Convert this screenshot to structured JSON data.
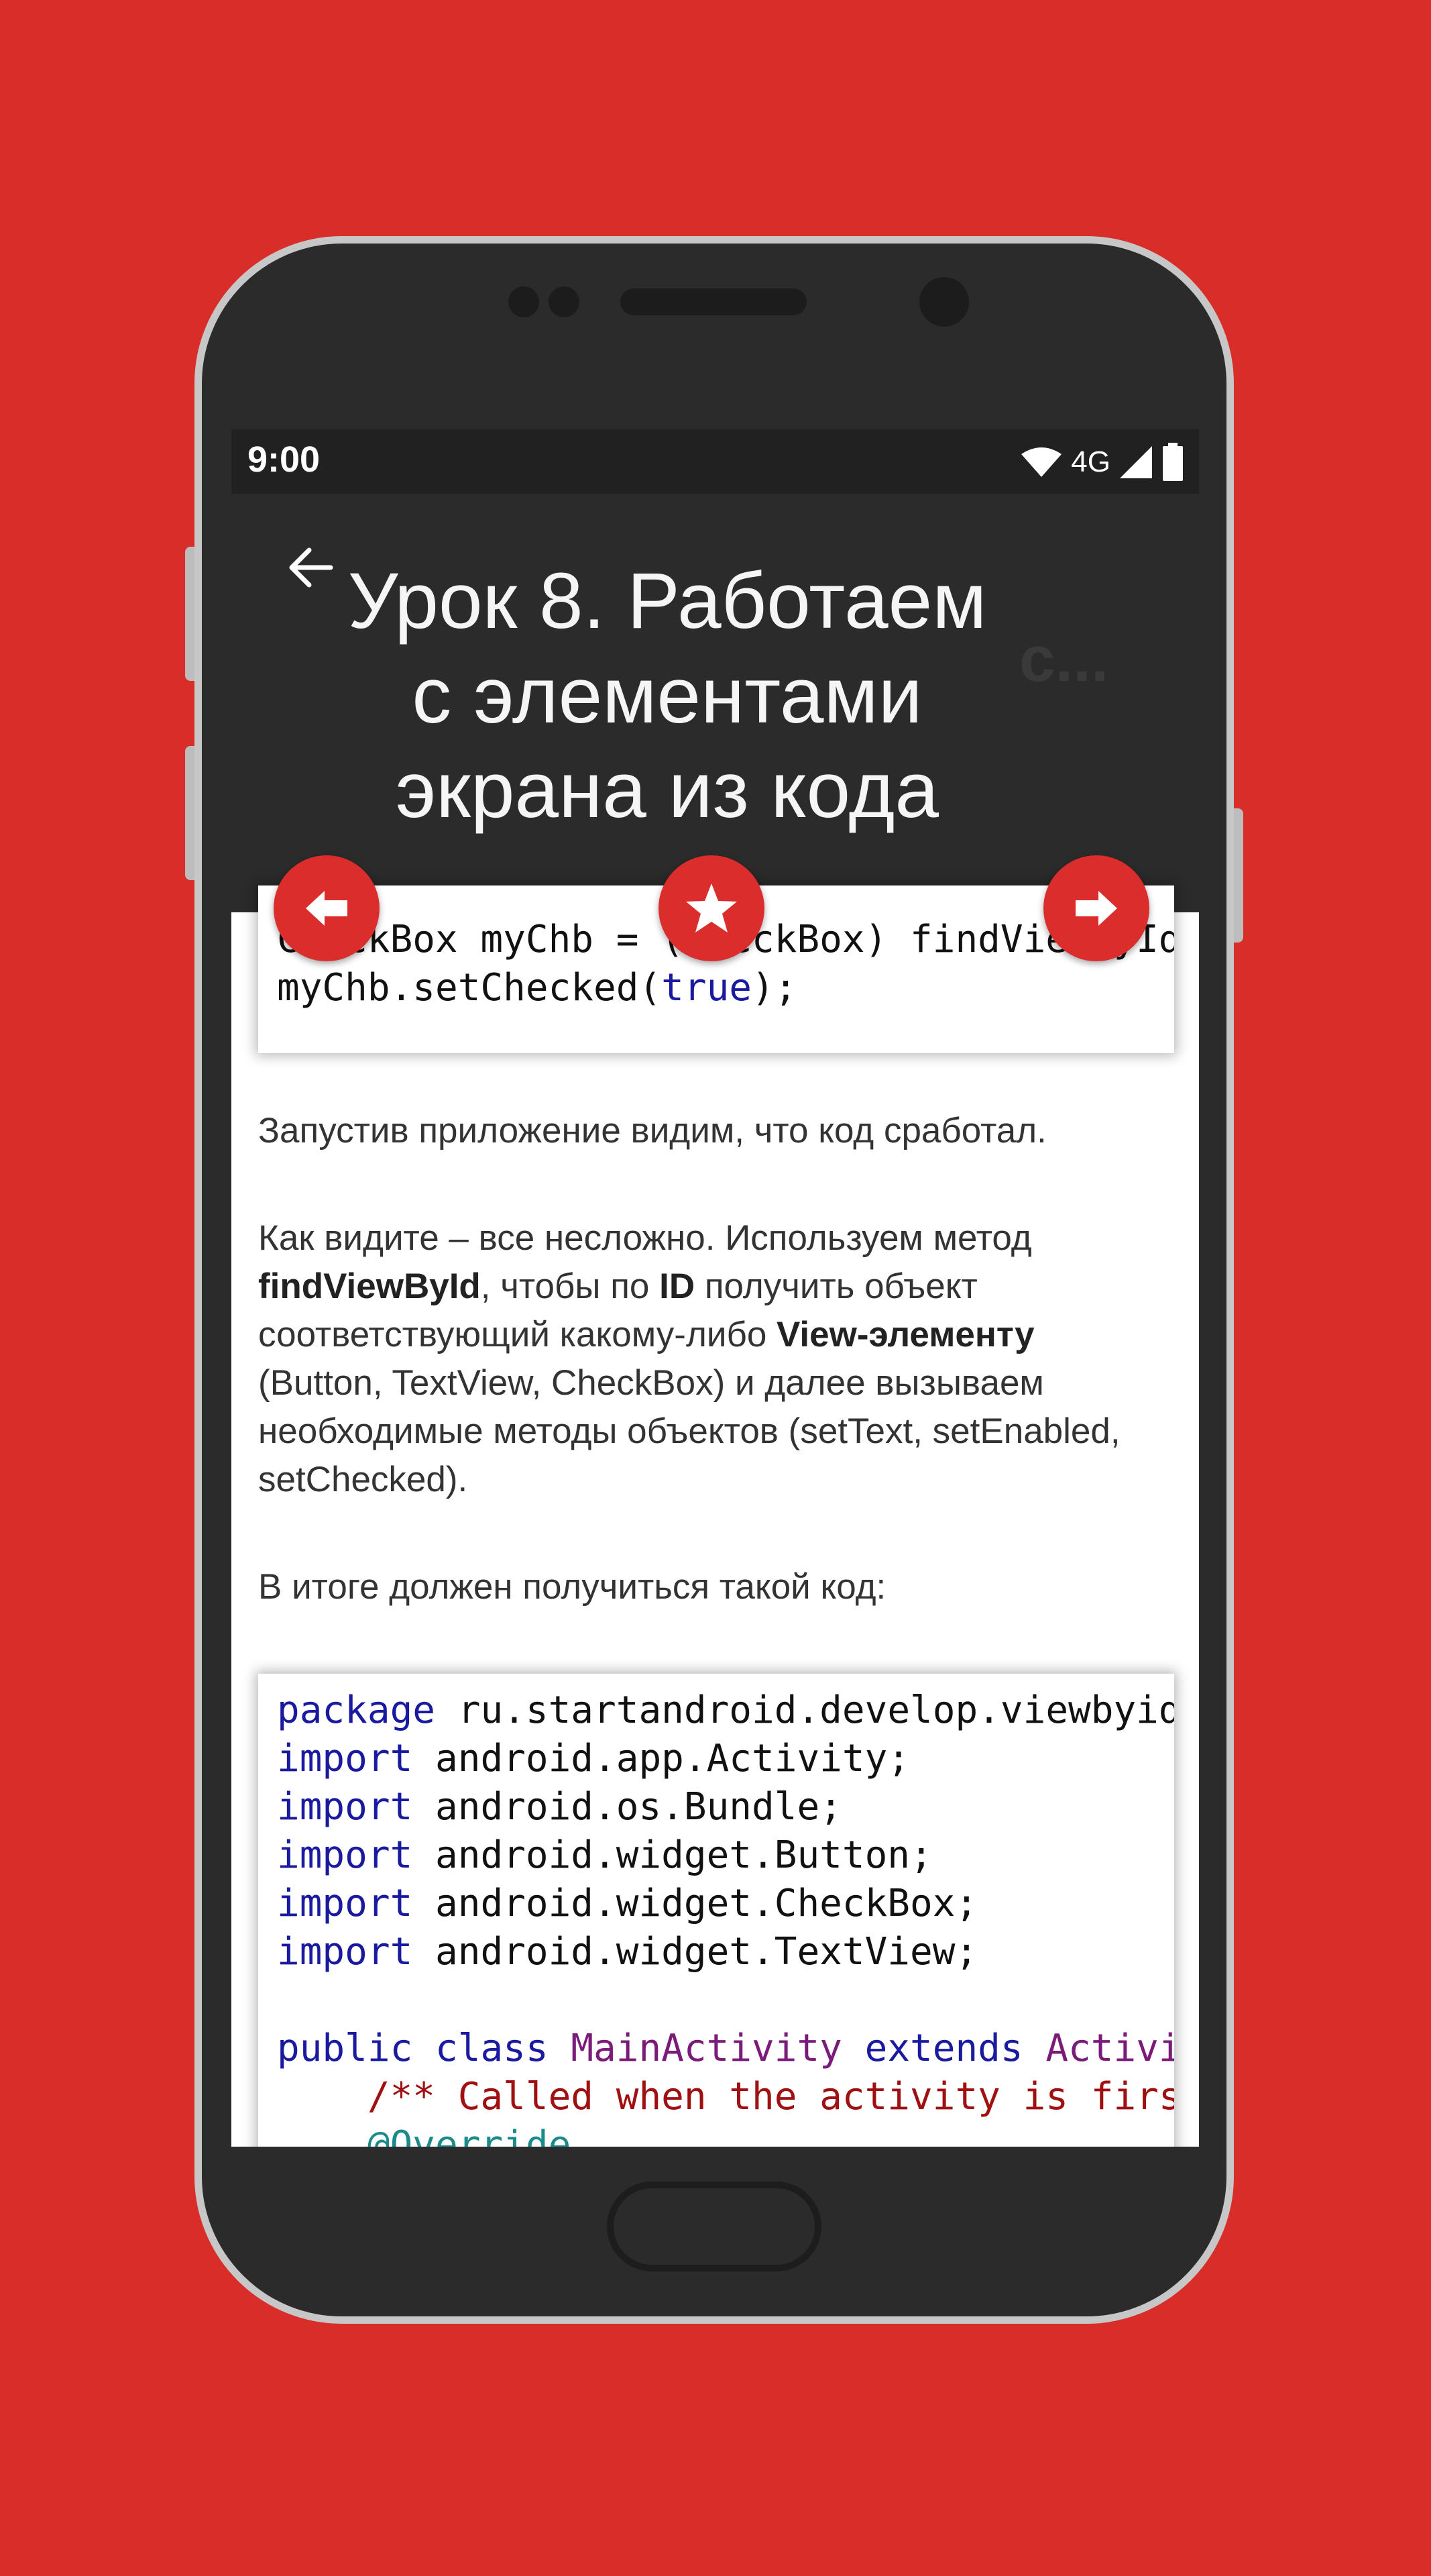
{
  "status_bar": {
    "time": "9:00",
    "network": "4G"
  },
  "app_bar": {
    "title": "Урок 8. Работаем с элементами экрана из кода",
    "title_overflow": "с..."
  },
  "code_top": {
    "line1": {
      "a": "CheckBox myChb = (CheckBox) findViewById"
    },
    "line2": {
      "a": "myChb.setChecked(",
      "b": "true",
      "c": ");"
    }
  },
  "para1": "Запустив приложение видим, что код сработал.",
  "para2": {
    "t1": "Как видите – все несложно. Используем метод ",
    "b1": "findViewById",
    "t2": ",  чтобы по ",
    "b2": "ID",
    "t3": " получить объект соответствующий какому-либо ",
    "b3": "View-элементу",
    "t4": " (Button, TextView, CheckBox) и далее вызываем необходимые методы объектов (setText, setEnabled, setChecked)."
  },
  "para3": "В итоге должен получиться такой код:",
  "code_bottom": {
    "l1": {
      "kw": "package",
      "rest": " ru.startandroid.develop.viewbyid;"
    },
    "l2": {
      "kw": "import",
      "rest": " android.app.Activity;"
    },
    "l3": {
      "kw": "import",
      "rest": " android.os.Bundle;"
    },
    "l4": {
      "kw": "import",
      "rest": " android.widget.Button;"
    },
    "l5": {
      "kw": "import",
      "rest": " android.widget.CheckBox;"
    },
    "l6": {
      "kw": "import",
      "rest": " android.widget.TextView;"
    },
    "l7": {
      "kw1": "public",
      "kw2": "class",
      "cls1": "MainActivity",
      "kw3": "extends",
      "cls2": "Activity {"
    },
    "l8": {
      "cm": "/** Called when the activity is first created. */"
    },
    "l9": {
      "ann": "@Override"
    }
  },
  "colors": {
    "accent": "#db2d2b",
    "background": "#d92d2a",
    "app_bar": "#2b2b2b",
    "status_bar": "#212121"
  },
  "icons": {
    "back": "arrow-left-icon",
    "prev": "arrow-left-bold-icon",
    "fav": "star-icon",
    "next": "arrow-right-bold-icon"
  }
}
